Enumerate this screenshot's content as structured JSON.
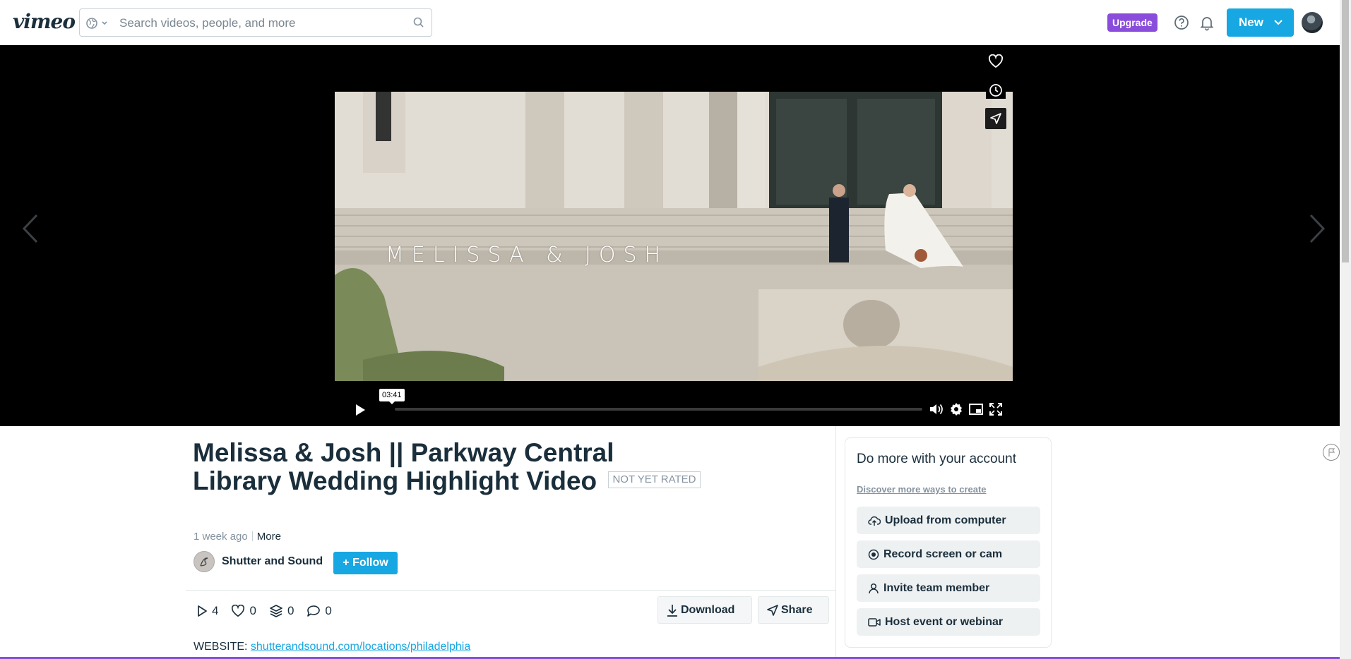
{
  "header": {
    "logo": "vimeo",
    "search_placeholder": "Search videos, people, and more",
    "upgrade_label": "Upgrade",
    "new_label": "New"
  },
  "player": {
    "overlay_title": "MELISSA & JOSH",
    "time_tooltip": "03:41",
    "progress": 0
  },
  "video": {
    "title": "Melissa & Josh || Parkway Central Library Wedding Highlight Video",
    "rating": "NOT YET RATED",
    "posted": "1 week ago",
    "more_label": "More",
    "creator": "Shutter and Sound",
    "follow_label": "+ Follow",
    "stats": {
      "plays": "4",
      "likes": "0",
      "collections": "0",
      "comments": "0"
    },
    "download_label": "Download",
    "share_label": "Share",
    "website_label": "WEBSITE:",
    "website_url": "shutterandsound.com/locations/philadelphia"
  },
  "panel": {
    "title": "Do more with your account",
    "link": "Discover more ways to create",
    "buttons": [
      "Upload from computer",
      "Record screen or cam",
      "Invite team member",
      "Host event or webinar"
    ]
  },
  "colors": {
    "accent": "#17a7e2",
    "upgrade": "#8a4ddb",
    "text": "#1a2e3b"
  }
}
